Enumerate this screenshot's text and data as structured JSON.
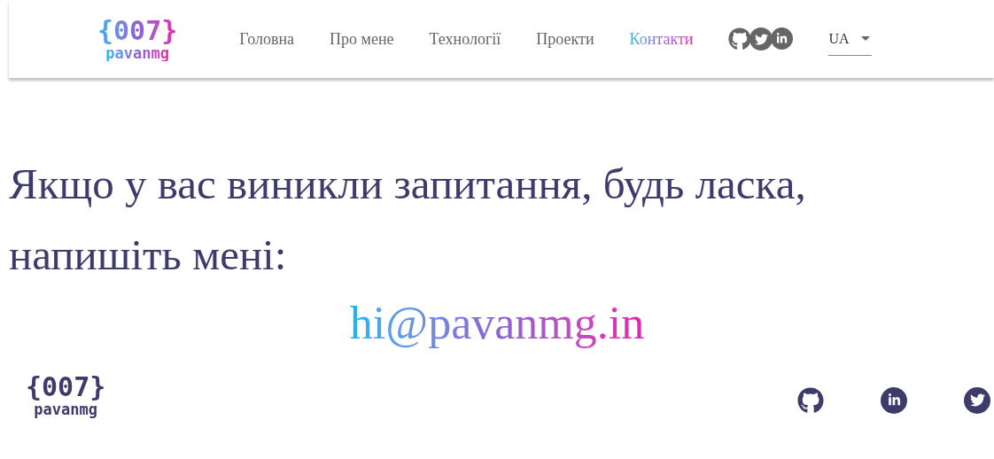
{
  "header": {
    "logo": {
      "code": "{007}",
      "name": "pavanmg"
    },
    "nav": [
      {
        "label": "Головна",
        "selected": false
      },
      {
        "label": "Про мене",
        "selected": false
      },
      {
        "label": "Технології",
        "selected": false
      },
      {
        "label": "Проекти",
        "selected": false
      },
      {
        "label": "Контакти",
        "selected": true
      }
    ],
    "language": {
      "value": "UA"
    }
  },
  "contact": {
    "heading": "Якщо у вас виникли запитання, будь ласка, напишіть мені:",
    "email": "hi@pavanmg.in"
  },
  "footer": {
    "logo": {
      "code": "{007}",
      "name": "pavanmg"
    }
  }
}
